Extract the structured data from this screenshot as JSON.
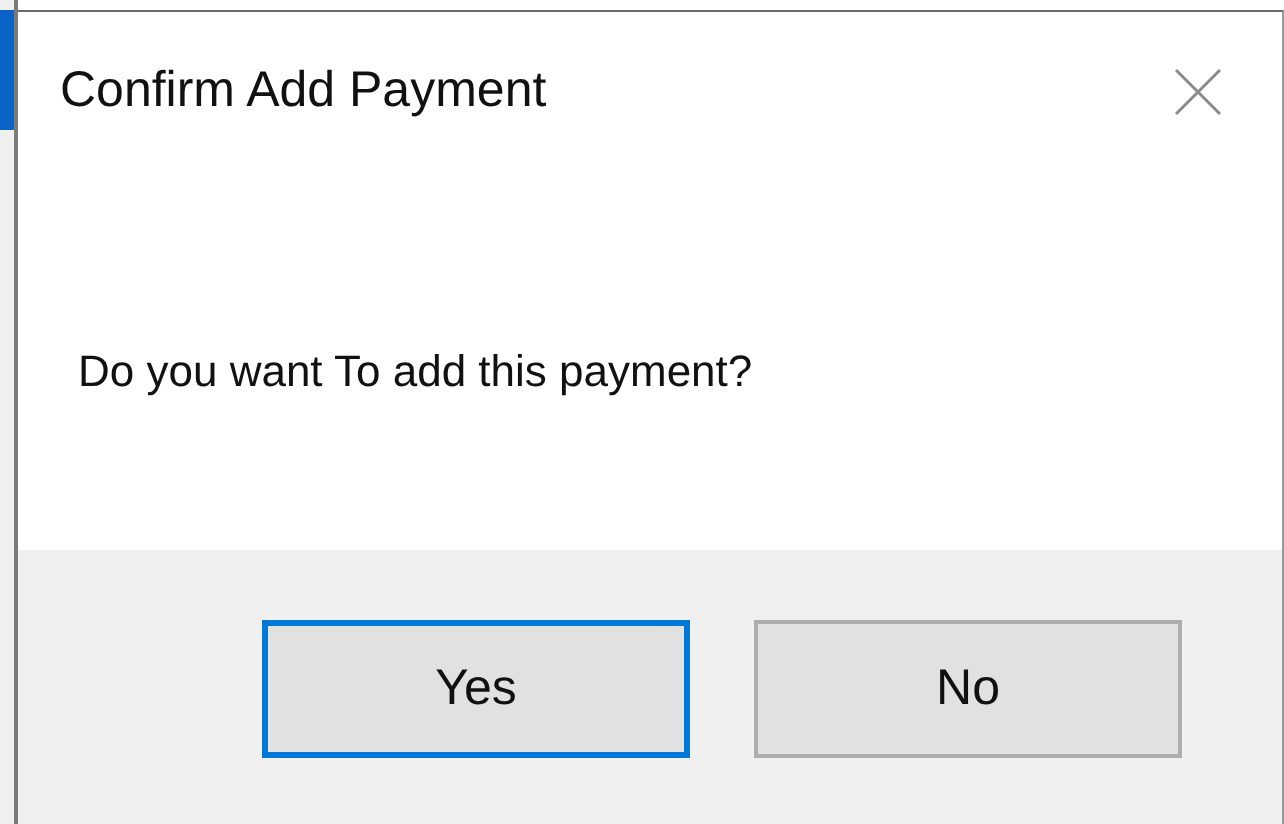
{
  "dialog": {
    "title": "Confirm Add Payment",
    "message": "Do you want To add this payment?",
    "buttons": [
      {
        "label": "Yes",
        "focused": true
      },
      {
        "label": "No",
        "focused": false
      }
    ]
  }
}
